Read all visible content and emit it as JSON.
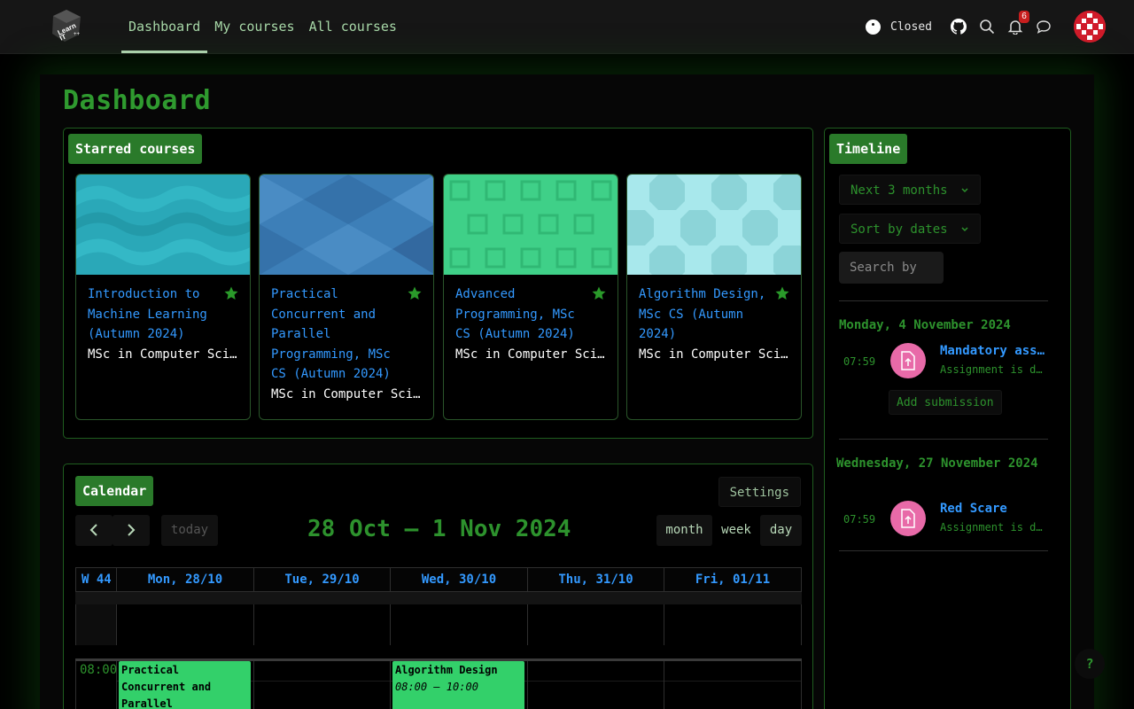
{
  "brand": {
    "logo_text": "Learn IT ++"
  },
  "nav": {
    "links": [
      {
        "label": "Dashboard"
      },
      {
        "label": "My courses"
      },
      {
        "label": "All courses"
      }
    ],
    "status_label": "Closed",
    "notification_count": "6"
  },
  "page": {
    "title": "Dashboard"
  },
  "starred": {
    "heading": "Starred courses",
    "courses": [
      {
        "name": "Introduction to Machine Learning (Autumn 2024)",
        "category": "MSc in Computer Science"
      },
      {
        "name": "Practical Concurrent and Parallel Programming, MSc CS (Autumn 2024)",
        "category": "MSc in Computer Science"
      },
      {
        "name": "Advanced Programming, MSc CS (Autumn 2024)",
        "category": "MSc in Computer Science"
      },
      {
        "name": "Algorithm Design, MSc CS (Autumn 2024)",
        "category": "MSc in Computer Science"
      }
    ]
  },
  "calendar": {
    "heading": "Calendar",
    "settings_label": "Settings",
    "prev_label": "‹",
    "next_label": "›",
    "today_label": "today",
    "range_title": "28 Oct – 1 Nov 2024",
    "views": [
      "month",
      "week",
      "day"
    ],
    "week_label": "W 44",
    "days": [
      "Mon, 28/10",
      "Tue, 29/10",
      "Wed, 30/10",
      "Thu, 31/10",
      "Fri, 01/11"
    ],
    "time_label": "08:00",
    "events": [
      {
        "title": "Practical Concurrent and Parallel",
        "time": ""
      },
      {
        "title": "Algorithm Design",
        "time": "08:00 – 10:00"
      }
    ]
  },
  "timeline": {
    "heading": "Timeline",
    "range_select": "Next 3 months",
    "sort_select": "Sort by dates",
    "search_placeholder": "Search by",
    "groups": [
      {
        "date": "Monday, 4 November 2024",
        "time": "07:59",
        "name": "Mandatory assignment",
        "sub": "Assignment is due",
        "action": "Add submission"
      },
      {
        "date": "Wednesday, 27 November 2024",
        "time": "07:59",
        "name": "Red Scare",
        "sub": "Assignment is due"
      }
    ]
  },
  "help": {
    "label": "?"
  },
  "colors": {
    "accent_green": "#2d922d",
    "link_blue": "#3399ff",
    "event_green": "#33d06a",
    "timeline_icon_pink": "#e86aa8"
  }
}
